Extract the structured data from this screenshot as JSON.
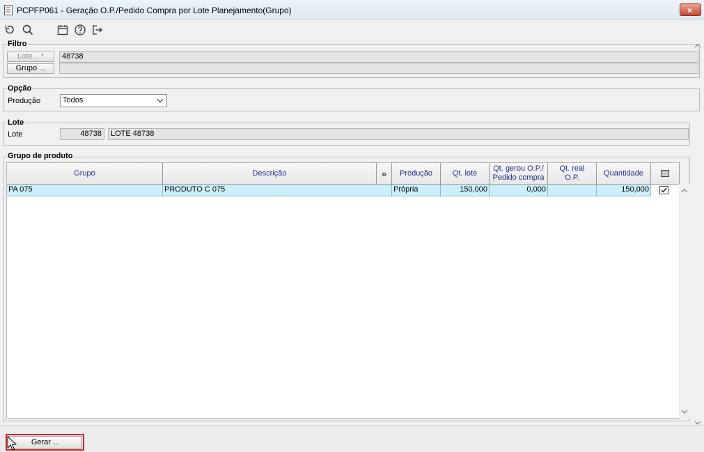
{
  "window": {
    "title": "PCPFP061 - Geração O.P./Pedido Compra por Lote Planejamento(Grupo)",
    "close_label": "×"
  },
  "toolbar": {
    "icons": [
      "undo-icon",
      "search-icon",
      "calendar-icon",
      "help-icon",
      "exit-icon"
    ]
  },
  "filtro": {
    "legend": "Filtro",
    "lote_button": "Lote... *",
    "lote_value": "48738",
    "grupo_button": "Grupo ...",
    "grupo_value": ""
  },
  "opcao": {
    "legend": "Opção",
    "producao_label": "Produção",
    "producao_selected": "Todos"
  },
  "lote": {
    "legend": "Lote",
    "label": "Lote",
    "number": "48738",
    "description": "LOTE 48738"
  },
  "grupo_produto": {
    "legend": "Grupo de produto",
    "columns": {
      "grupo": "Grupo",
      "descricao": "Descrição",
      "expand": "»",
      "producao": "Produção",
      "qt_lote": "Qt. lote",
      "qt_gerou_1": "Qt. gerou O.P./",
      "qt_gerou_2": "Pedido compra",
      "qt_real_1": "Qt. real",
      "qt_real_2": "O.P.",
      "quantidade": "Quantidade"
    },
    "rows": [
      {
        "grupo": "PA 075",
        "descricao": "PRODUTO C 075",
        "producao": "Própria",
        "qt_lote": "150,000",
        "qt_gerou": "0,000",
        "qt_real": "",
        "quantidade": "150,000",
        "checked": true
      }
    ]
  },
  "footer": {
    "gerar_button": "Gerar ..."
  },
  "colors": {
    "header_text": "#1d2b8c",
    "selected_row": "#cdeefb",
    "highlight_border": "#e02020"
  }
}
